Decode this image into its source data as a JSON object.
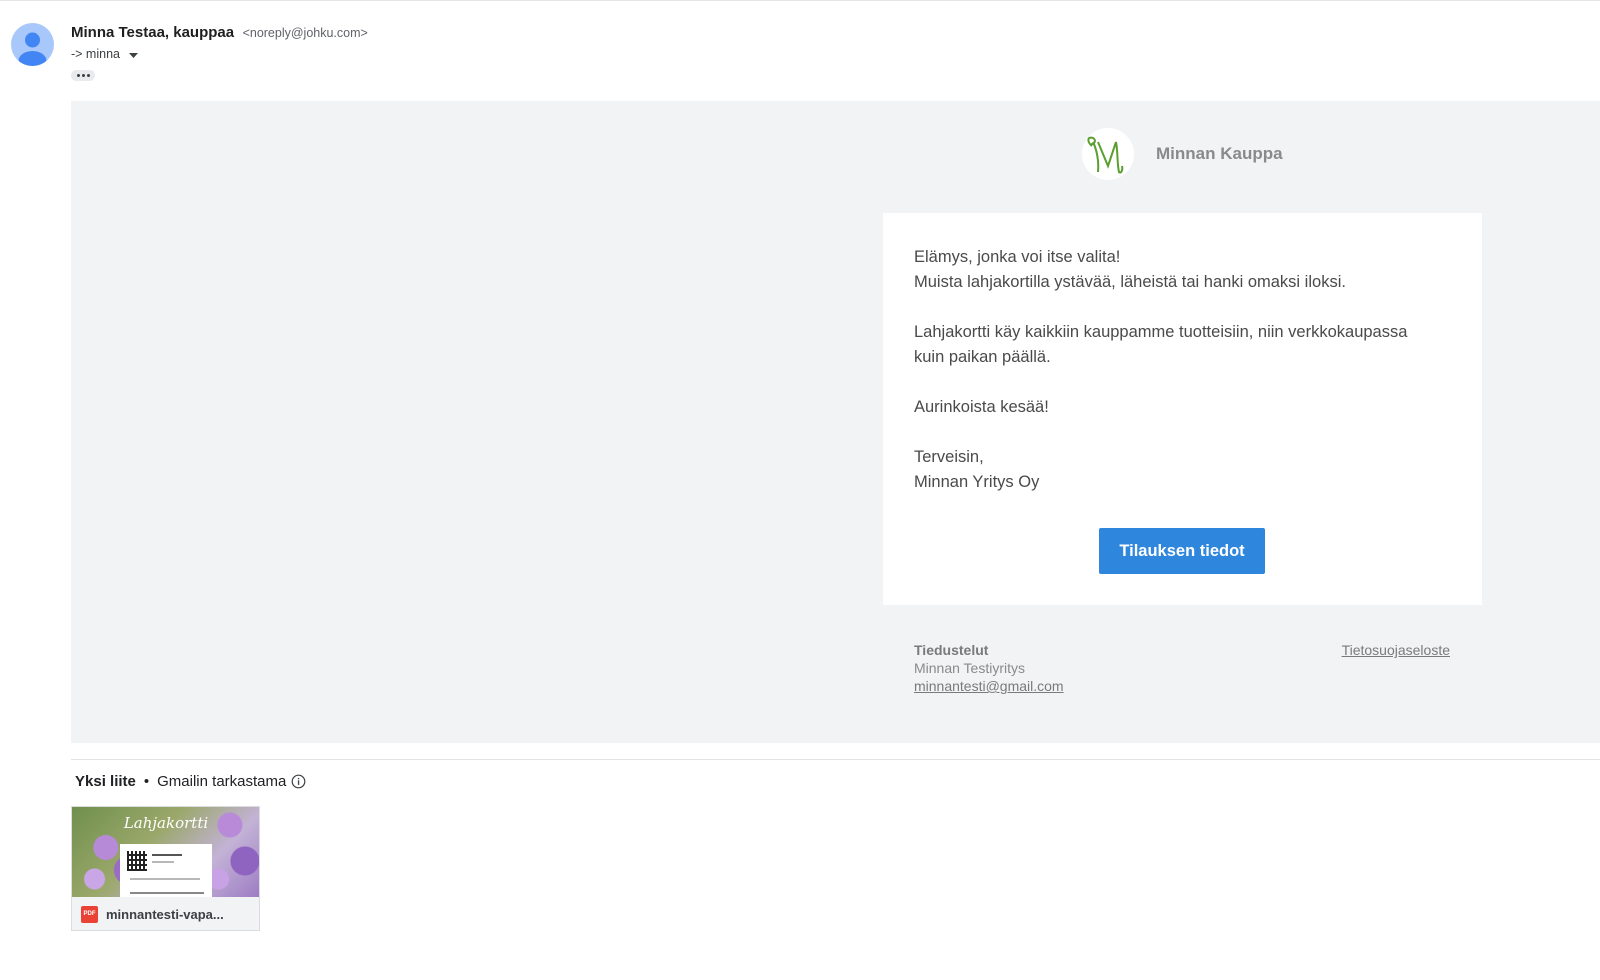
{
  "header": {
    "sender_name": "Minna Testaa, kauppaa",
    "sender_email": "<noreply@johku.com>",
    "recipient": "-> minna",
    "more_label": "•••"
  },
  "email": {
    "brand_name": "Minnan Kauppa",
    "paragraphs": [
      {
        "line1": "Elämys, jonka voi itse valita!",
        "line2": "Muista lahjakortilla ystävää, läheistä tai hanki omaksi iloksi."
      },
      {
        "line1": "Lahjakortti käy kaikkiin kauppamme tuotteisiin, niin verkkokaupassa",
        "line2": "kuin paikan päällä."
      },
      {
        "line1": "Aurinkoista kesää!"
      },
      {
        "line1": "Terveisin,",
        "line2": "Minnan Yritys Oy"
      }
    ],
    "cta_label": "Tilauksen tiedot",
    "footer": {
      "title": "Tiedustelut",
      "company": "Minnan Testiyritys",
      "email": "minnantesti@gmail.com",
      "privacy_link": "Tietosuojaseloste"
    }
  },
  "attachments": {
    "count_label": "Yksi liite",
    "separator": "•",
    "scan_label": "Gmailin tarkastama",
    "items": [
      {
        "name": "minnantesti-vapa...",
        "type_label": "PDF",
        "thumbnail_title": "Lahjakortti"
      }
    ]
  },
  "colors": {
    "cta_background": "#2f86dd",
    "body_background": "#f2f3f5",
    "logo_green": "#5a9e2f",
    "pdf_red": "#ea4335"
  },
  "icons": [
    "account-avatar-icon",
    "caret-down-icon",
    "more-options-icon",
    "brand-logo-icon",
    "info-icon",
    "pdf-icon"
  ]
}
